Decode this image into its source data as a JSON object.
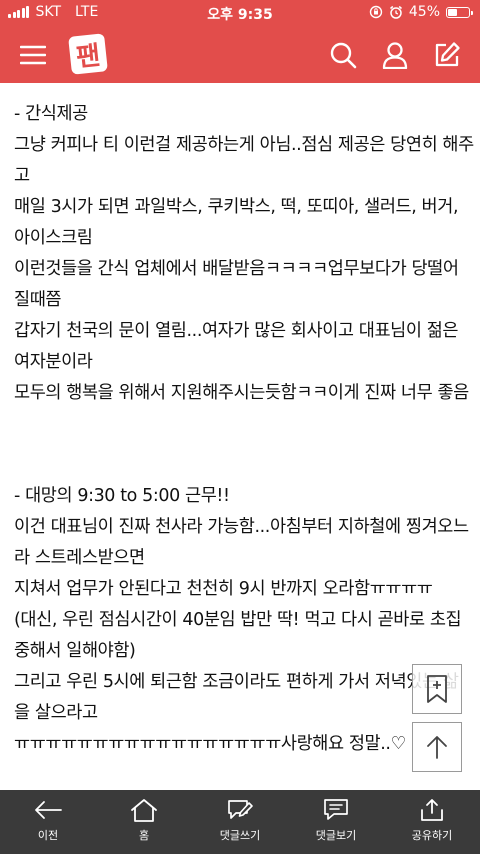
{
  "status_bar": {
    "carrier": "SKT",
    "network": "LTE",
    "time": "오후 9:35",
    "battery_text": "45%",
    "battery_level": 0.45
  },
  "nav": {
    "logo_text": "팬",
    "icons": [
      "menu-icon",
      "search-icon",
      "user-icon",
      "edit-icon"
    ],
    "accent_color": "#e24d4b"
  },
  "article": {
    "paragraphs": [
      "- 간식제공",
      "  그냥 커피나 티 이런걸 제공하는게 아님..점심 제공은 당연히 해주고",
      "  매일 3시가 되면 과일박스, 쿠키박스, 떡, 또띠아, 샐러드, 버거, 아이스크림",
      "  이런것들을 간식 업체에서 배달받음ㅋㅋㅋㅋ업무보다가 당떨어질때쯤",
      "  갑자기 천국의 문이 열림...여자가 많은 회사이고 대표님이 젊은 여자분이라",
      "  모두의 행복을 위해서 지원해주시는듯함ㅋㅋ이게 진짜 너무 좋음",
      "- 대망의 9:30 to 5:00 근무!!",
      "  이건 대표님이 진짜 천사라 가능함...아침부터 지하철에 찡겨오느라 스트레스받으면",
      "  지쳐서 업무가 안된다고 천천히 9시 반까지 오라함ㅠㅠㅠㅠ",
      "  (대신, 우린 점심시간이 40분임 밥만 딱! 먹고 다시 곧바로 초집중해서 일해야함)",
      "  그리고 우린 5시에 퇴근함 조금이라도 편하게 가서 저녁있는 삶을 살으라고",
      "  ㅠㅠㅠㅠㅠㅠㅠㅠㅠㅠㅠㅠㅠㅠㅠㅠㅠ사랑해요 정말..♡"
    ]
  },
  "floating": {
    "add_bookmark_icon": "bookmark-plus-icon",
    "scroll_top_icon": "arrow-up-icon"
  },
  "bottom_bar": {
    "items": [
      {
        "label": "이전",
        "icon": "back-arrow-icon"
      },
      {
        "label": "홈",
        "icon": "home-icon"
      },
      {
        "label": "댓글쓰기",
        "icon": "comment-write-icon"
      },
      {
        "label": "댓글보기",
        "icon": "comment-view-icon"
      },
      {
        "label": "공유하기",
        "icon": "share-icon"
      }
    ]
  }
}
